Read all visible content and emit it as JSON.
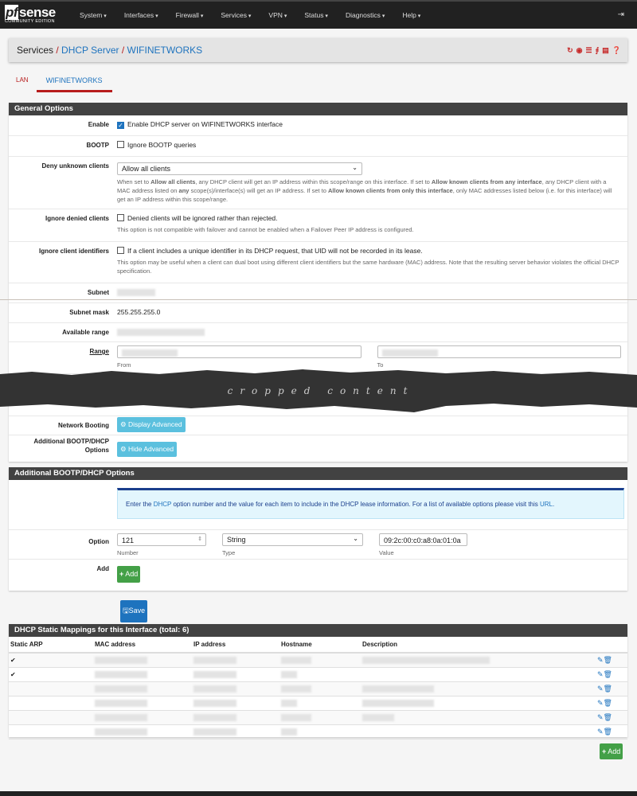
{
  "nav": {
    "logo_brand": "pfsense",
    "logo_sub": "COMMUNITY EDITION",
    "menu": [
      "System",
      "Interfaces",
      "Firewall",
      "Services",
      "VPN",
      "Status",
      "Diagnostics",
      "Help"
    ]
  },
  "breadcrumb": {
    "root": "Services",
    "level2": "DHCP Server",
    "current": "WIFINETWORKS",
    "icons": [
      "restart-service-icon",
      "stop-service-icon",
      "settings-icon",
      "graph-icon",
      "log-icon",
      "help-icon"
    ]
  },
  "tabs": [
    {
      "label": "LAN",
      "active": false
    },
    {
      "label": "WIFINETWORKS",
      "active": true
    }
  ],
  "general": {
    "title": "General Options",
    "enable_label": "Enable",
    "enable_text": "Enable DHCP server on WIFINETWORKS interface",
    "enable_checked": true,
    "bootp_label": "BOOTP",
    "bootp_text": "Ignore BOOTP queries",
    "deny_label": "Deny unknown clients",
    "deny_value": "Allow all clients",
    "deny_help": {
      "p1": "When set to ",
      "b1": "Allow all clients",
      "p2": ", any DHCP client will get an IP address within this scope/range on this interface. If set to ",
      "b2": "Allow known clients from any interface",
      "p3": ", any DHCP client with a MAC address listed on ",
      "b3": "any",
      "p4": " scope(s)/interface(s) will get an IP address. If set to ",
      "b4": "Allow known clients from only this interface",
      "p5": ", only MAC addresses listed below (i.e. for this interface) will get an IP address within this scope/range."
    },
    "ignore_denied_label": "Ignore denied clients",
    "ignore_denied_text": "Denied clients will be ignored rather than rejected.",
    "ignore_denied_help": "This option is not compatible with failover and cannot be enabled when a Failover Peer IP address is configured.",
    "ignore_uid_label": "Ignore client identifiers",
    "ignore_uid_text": "If a client includes a unique identifier in its DHCP request, that UID will not be recorded in its lease.",
    "ignore_uid_help": "This option may be useful when a client can dual boot using different client identifiers but the same hardware (MAC) address. Note that the resulting server behavior violates the official DHCP specification.",
    "subnet_label": "Subnet",
    "subnet_mask_label": "Subnet mask",
    "subnet_mask": "255.255.255.0",
    "available_range_label": "Available range",
    "range_label": "Range",
    "from_label": "From",
    "to_label": "To",
    "cropped_text": "cropped content",
    "netboot_label": "Network Booting",
    "netboot_button": "Display Advanced",
    "additional_label": "Additional BOOTP/DHCP Options",
    "additional_button": "Hide Advanced"
  },
  "bootp_options": {
    "title": "Additional BOOTP/DHCP Options",
    "info_p1": "Enter the ",
    "info_link1": "DHCP",
    "info_p2": " option number and the value for each item to include in the DHCP lease information. For a list of available options please visit this ",
    "info_link2": "URL",
    "info_p3": ".",
    "option_label": "Option",
    "number": "121",
    "type": "String",
    "value": "09:2c:00:c0:a8:0a:01:0a",
    "number_label": "Number",
    "type_label": "Type",
    "value_label": "Value",
    "add_label": "Add",
    "add_button": "Add"
  },
  "save_button": "Save",
  "mappings": {
    "title": "DHCP Static Mappings for this Interface (total: 6)",
    "columns": [
      "Static ARP",
      "MAC address",
      "IP address",
      "Hostname",
      "Description"
    ],
    "rows": [
      {
        "static_arp": true
      },
      {
        "static_arp": true
      },
      {
        "static_arp": false
      },
      {
        "static_arp": false
      },
      {
        "static_arp": false
      },
      {
        "static_arp": false
      }
    ],
    "add_button": "Add"
  },
  "colors": {
    "navbar": "#212121",
    "accent_red": "#b71c1c",
    "link_blue": "#1e73be",
    "info_button": "#5bc0de",
    "success": "#43a047"
  }
}
